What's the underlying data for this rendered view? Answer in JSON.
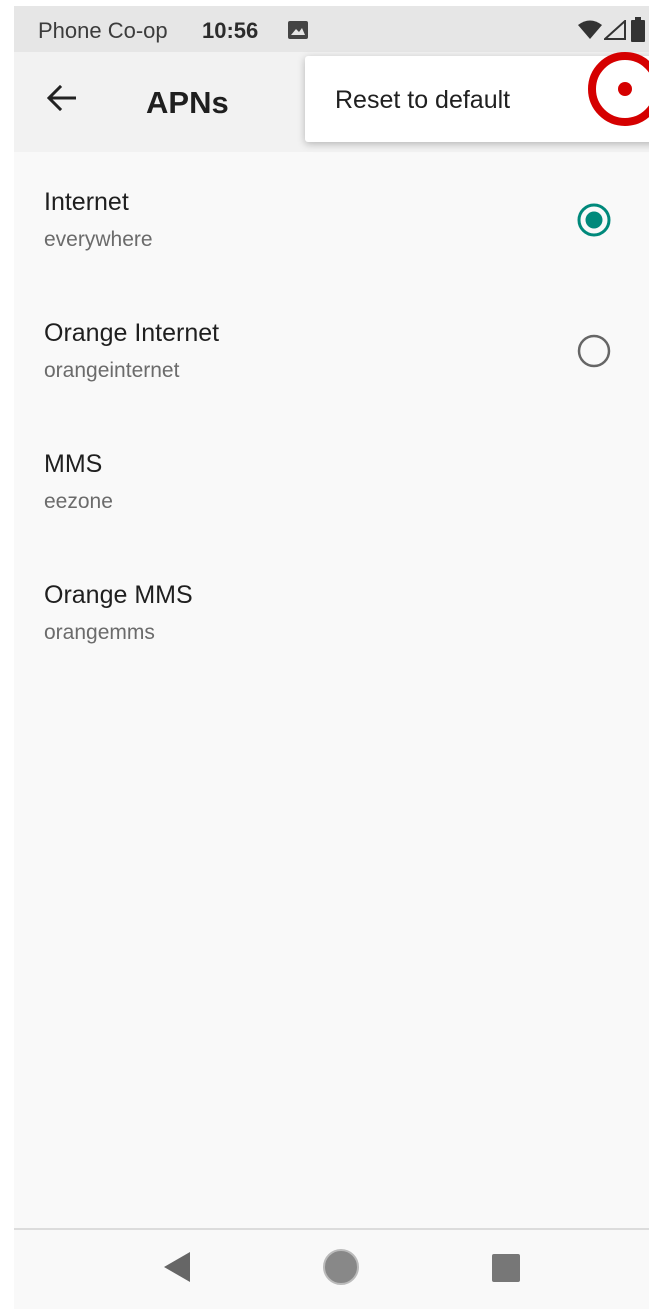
{
  "status_bar": {
    "carrier": "Phone Co-op",
    "time": "10:56",
    "icons": [
      "image-notification-icon",
      "wifi-icon",
      "cell-signal-icon",
      "battery-icon"
    ]
  },
  "app_bar": {
    "title": "APNs",
    "back_icon": "arrow-left-icon"
  },
  "overflow_menu": {
    "items": [
      {
        "label": "Reset to default"
      }
    ]
  },
  "apn_list": [
    {
      "name": "Internet",
      "apn": "everywhere",
      "has_radio": true,
      "selected": true
    },
    {
      "name": "Orange Internet",
      "apn": "orangeinternet",
      "has_radio": true,
      "selected": false
    },
    {
      "name": "MMS",
      "apn": "eezone",
      "has_radio": false,
      "selected": false
    },
    {
      "name": "Orange MMS",
      "apn": "orangemms",
      "has_radio": false,
      "selected": false
    }
  ],
  "nav_bar": {
    "icons": [
      "nav-back-icon",
      "nav-home-icon",
      "nav-recents-icon"
    ]
  },
  "colors": {
    "accent": "#00897b",
    "tap_marker": "#d50000",
    "radio_unselected": "#666666"
  }
}
